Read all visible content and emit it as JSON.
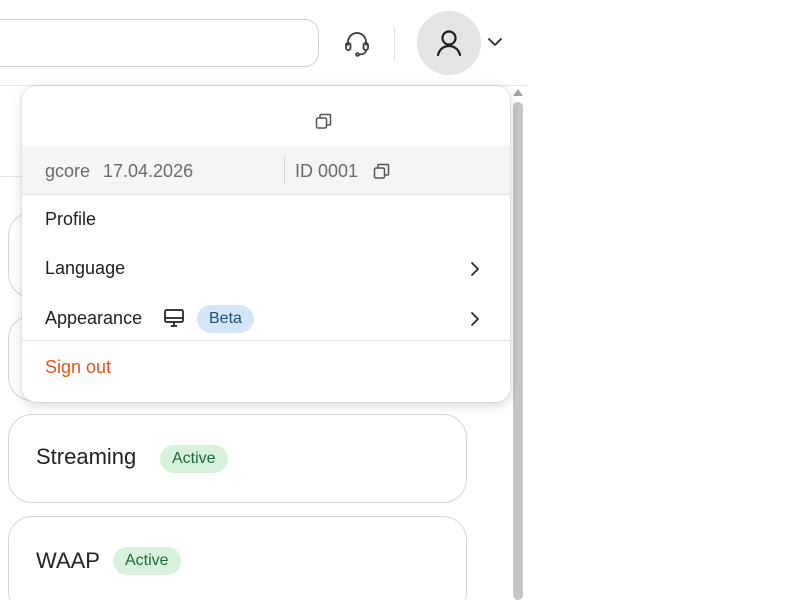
{
  "header": {
    "support_icon": "headset-icon",
    "avatar_icon": "user-icon",
    "chevron_icon": "chevron-down-icon"
  },
  "cards": [
    {
      "title": "Streaming",
      "status": "Active"
    },
    {
      "title": "WAAP",
      "status": "Active"
    }
  ],
  "menu": {
    "copy_icon": "copy-icon",
    "account": {
      "name": "gcore",
      "date": "17.04.2026",
      "id": "ID 0001"
    },
    "items": [
      {
        "label": "Profile"
      },
      {
        "label": "Language"
      },
      {
        "label": "Appearance",
        "badge": "Beta",
        "icon": "monitor-icon"
      }
    ],
    "sign_out": "Sign out"
  },
  "colors": {
    "accent_orange": "#e6531c",
    "active_badge_bg": "#d7f1dc",
    "active_badge_text": "#1c6b32",
    "beta_badge_bg": "#d4e5f8",
    "beta_badge_text": "#21507f"
  }
}
